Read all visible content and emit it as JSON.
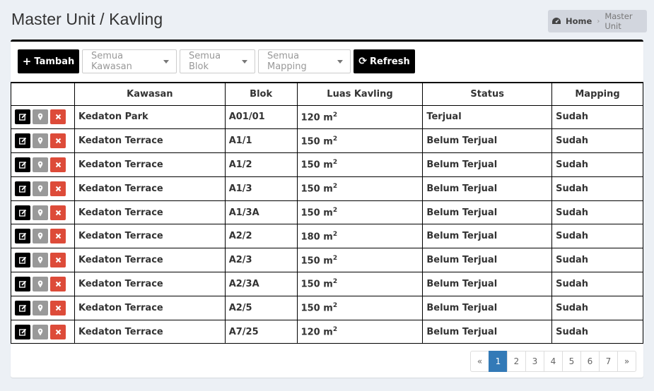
{
  "page": {
    "title": "Master Unit / Kavling"
  },
  "breadcrumb": {
    "home": "Home",
    "current": "Master Unit"
  },
  "toolbar": {
    "add_label": "Tambah",
    "filter_kawasan": "Semua Kawasan",
    "filter_blok": "Semua Blok",
    "filter_mapping": "Semua Mapping",
    "refresh_label": "Refresh"
  },
  "table": {
    "columns": [
      "",
      "Kawasan",
      "Blok",
      "Luas Kavling",
      "Status",
      "Mapping"
    ],
    "rows": [
      {
        "kawasan": "Kedaton Park",
        "blok": "A01/01",
        "luas": "120 m",
        "status": "Terjual",
        "mapping": "Sudah"
      },
      {
        "kawasan": "Kedaton Terrace",
        "blok": "A1/1",
        "luas": "150 m",
        "status": "Belum Terjual",
        "mapping": "Sudah"
      },
      {
        "kawasan": "Kedaton Terrace",
        "blok": "A1/2",
        "luas": "150 m",
        "status": "Belum Terjual",
        "mapping": "Sudah"
      },
      {
        "kawasan": "Kedaton Terrace",
        "blok": "A1/3",
        "luas": "150 m",
        "status": "Belum Terjual",
        "mapping": "Sudah"
      },
      {
        "kawasan": "Kedaton Terrace",
        "blok": "A1/3A",
        "luas": "150 m",
        "status": "Belum Terjual",
        "mapping": "Sudah"
      },
      {
        "kawasan": "Kedaton Terrace",
        "blok": "A2/2",
        "luas": "180 m",
        "status": "Belum Terjual",
        "mapping": "Sudah"
      },
      {
        "kawasan": "Kedaton Terrace",
        "blok": "A2/3",
        "luas": "150 m",
        "status": "Belum Terjual",
        "mapping": "Sudah"
      },
      {
        "kawasan": "Kedaton Terrace",
        "blok": "A2/3A",
        "luas": "150 m",
        "status": "Belum Terjual",
        "mapping": "Sudah"
      },
      {
        "kawasan": "Kedaton Terrace",
        "blok": "A2/5",
        "luas": "150 m",
        "status": "Belum Terjual",
        "mapping": "Sudah"
      },
      {
        "kawasan": "Kedaton Terrace",
        "blok": "A7/25",
        "luas": "120 m",
        "status": "Belum Terjual",
        "mapping": "Sudah"
      }
    ],
    "area_superscript": "2"
  },
  "pagination": {
    "prev": "«",
    "pages": [
      "1",
      "2",
      "3",
      "4",
      "5",
      "6",
      "7"
    ],
    "active": "1",
    "next": "»"
  },
  "colors": {
    "accent": "#000000",
    "active_page": "#337ab7",
    "delete": "#dd4b39",
    "map": "#999999"
  },
  "icons": {
    "breadcrumb": "dashboard-icon",
    "add": "plus-icon",
    "refresh": "refresh-icon",
    "edit": "edit-icon",
    "map": "map-marker-icon",
    "delete": "close-icon"
  }
}
